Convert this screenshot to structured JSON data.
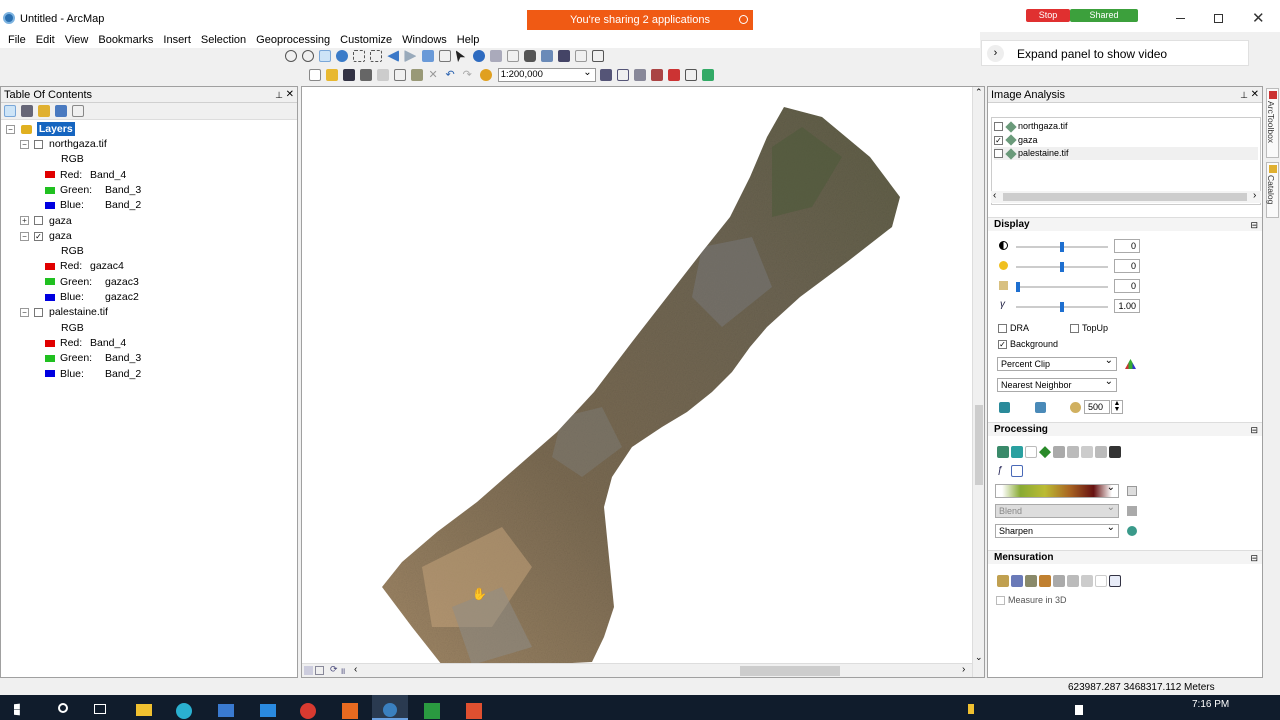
{
  "window": {
    "title": "Untitled - ArcMap"
  },
  "sharing": {
    "banner": "You're sharing 2 applications",
    "stop": "Stop",
    "shared": "Shared"
  },
  "video_panel": {
    "label": "Expand panel to show video"
  },
  "menu": [
    "File",
    "Edit",
    "View",
    "Bookmarks",
    "Insert",
    "Selection",
    "Geoprocessing",
    "Customize",
    "Windows",
    "Help"
  ],
  "toolbar": {
    "scale": "1:200,000"
  },
  "toc": {
    "title": "Table Of Contents",
    "root": "Layers",
    "layers": [
      {
        "name": "northgaza.tif",
        "checked": false,
        "expanded": true,
        "mode": "RGB",
        "bands": [
          {
            "label": "Red:",
            "value": "Band_4",
            "color": "#e00000"
          },
          {
            "label": "Green:",
            "value": "Band_3",
            "color": "#20c020"
          },
          {
            "label": "Blue:",
            "value": "Band_2",
            "color": "#0000e0"
          }
        ]
      },
      {
        "name": "gaza",
        "checked": false,
        "expanded": false,
        "mode": "",
        "bands": []
      },
      {
        "name": "gaza",
        "checked": true,
        "expanded": true,
        "mode": "RGB",
        "bands": [
          {
            "label": "Red:",
            "value": "gazac4",
            "color": "#e00000"
          },
          {
            "label": "Green:",
            "value": "gazac3",
            "color": "#20c020"
          },
          {
            "label": "Blue:",
            "value": "gazac2",
            "color": "#0000e0"
          }
        ]
      },
      {
        "name": "palestaine.tif",
        "checked": false,
        "expanded": true,
        "mode": "RGB",
        "bands": [
          {
            "label": "Red:",
            "value": "Band_4",
            "color": "#e00000"
          },
          {
            "label": "Green:",
            "value": "Band_3",
            "color": "#20c020"
          },
          {
            "label": "Blue:",
            "value": "Band_2",
            "color": "#0000e0"
          }
        ]
      }
    ]
  },
  "image_analysis": {
    "title": "Image Analysis",
    "layers": [
      {
        "name": "northgaza.tif",
        "checked": false
      },
      {
        "name": "gaza",
        "checked": true
      },
      {
        "name": "palestaine.tif",
        "checked": false
      }
    ],
    "display": {
      "title": "Display",
      "sliders": [
        {
          "value": "0",
          "level": 0.5
        },
        {
          "value": "0",
          "level": 0.5
        },
        {
          "value": "0",
          "level": 0.0
        },
        {
          "value": "1.00",
          "level": 0.5
        }
      ],
      "dra": "DRA",
      "topup": "TopUp",
      "background": "Background",
      "stretch": "Percent Clip",
      "resample": "Nearest Neighbor",
      "count": "500"
    },
    "processing": {
      "title": "Processing",
      "blend": "Blend",
      "sharpen": "Sharpen"
    },
    "mensuration": {
      "title": "Mensuration",
      "measure3d": "Measure in 3D"
    },
    "side_tabs": [
      "ArcToolbox",
      "Catalog"
    ]
  },
  "status": {
    "coords": "623987.287  3468317.112 Meters"
  },
  "taskbar": {
    "time": "7:16 PM"
  }
}
